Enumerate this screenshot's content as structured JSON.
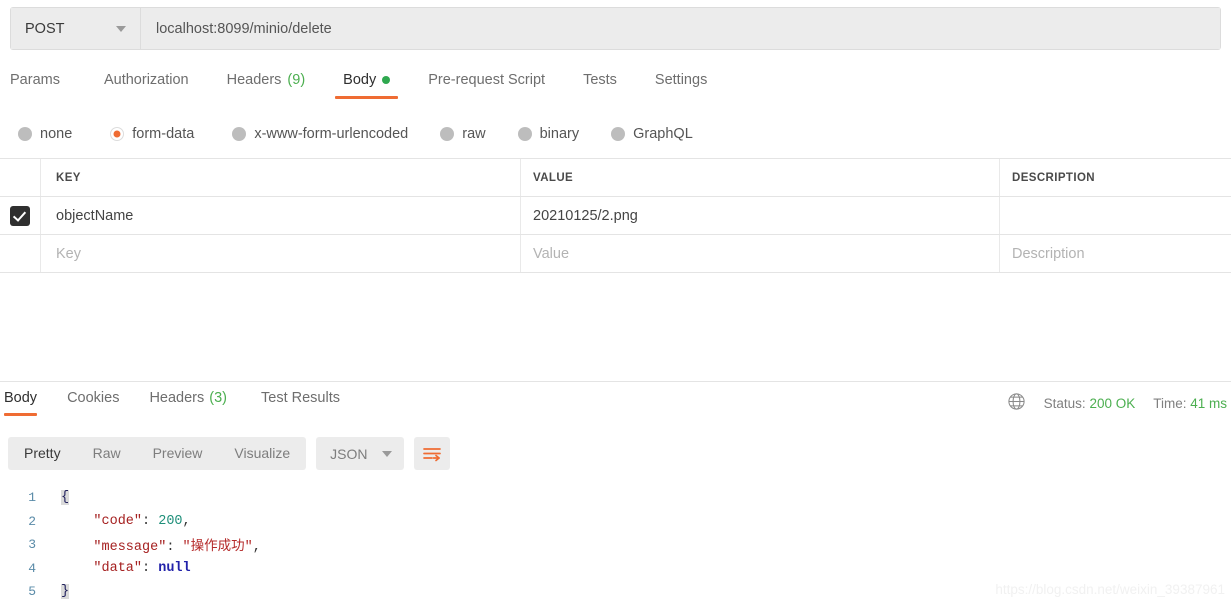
{
  "request": {
    "method": "POST",
    "url": "localhost:8099/minio/delete",
    "tabs": [
      {
        "label": "Params",
        "count": "",
        "active": false,
        "dot": false
      },
      {
        "label": "Authorization",
        "count": "",
        "active": false,
        "dot": false
      },
      {
        "label": "Headers",
        "count": "(9)",
        "active": false,
        "dot": false
      },
      {
        "label": "Body",
        "count": "",
        "active": true,
        "dot": true
      },
      {
        "label": "Pre-request Script",
        "count": "",
        "active": false,
        "dot": false
      },
      {
        "label": "Tests",
        "count": "",
        "active": false,
        "dot": false
      },
      {
        "label": "Settings",
        "count": "",
        "active": false,
        "dot": false
      }
    ],
    "body_types": [
      {
        "label": "none",
        "selected": false
      },
      {
        "label": "form-data",
        "selected": true
      },
      {
        "label": "x-www-form-urlencoded",
        "selected": false
      },
      {
        "label": "raw",
        "selected": false
      },
      {
        "label": "binary",
        "selected": false
      },
      {
        "label": "GraphQL",
        "selected": false
      }
    ],
    "table": {
      "columns": {
        "key": "KEY",
        "value": "VALUE",
        "description": "DESCRIPTION"
      },
      "rows": [
        {
          "checked": true,
          "key": "objectName",
          "value": "20210125/2.png",
          "description": ""
        }
      ],
      "placeholders": {
        "key": "Key",
        "value": "Value",
        "description": "Description"
      }
    }
  },
  "response": {
    "tabs": [
      {
        "label": "Body",
        "count": "",
        "active": true
      },
      {
        "label": "Cookies",
        "count": "",
        "active": false
      },
      {
        "label": "Headers",
        "count": "(3)",
        "active": false
      },
      {
        "label": "Test Results",
        "count": "",
        "active": false
      }
    ],
    "meta": {
      "status_label": "Status:",
      "status_value": "200 OK",
      "time_label": "Time:",
      "time_value": "41 ms"
    },
    "view_modes": [
      {
        "label": "Pretty",
        "active": true
      },
      {
        "label": "Raw",
        "active": false
      },
      {
        "label": "Preview",
        "active": false
      },
      {
        "label": "Visualize",
        "active": false
      }
    ],
    "format": "JSON",
    "code": {
      "lines": [
        {
          "n": "1",
          "parts": [
            {
              "t": "{",
              "c": "tok-brace"
            }
          ]
        },
        {
          "n": "2",
          "parts": [
            {
              "t": "    ",
              "c": "tok-punct"
            },
            {
              "t": "\"code\"",
              "c": "tok-key"
            },
            {
              "t": ": ",
              "c": "tok-punct"
            },
            {
              "t": "200",
              "c": "tok-num"
            },
            {
              "t": ",",
              "c": "tok-punct"
            }
          ]
        },
        {
          "n": "3",
          "parts": [
            {
              "t": "    ",
              "c": "tok-punct"
            },
            {
              "t": "\"message\"",
              "c": "tok-key"
            },
            {
              "t": ": ",
              "c": "tok-punct"
            },
            {
              "t": "\"操作成功\"",
              "c": "tok-str"
            },
            {
              "t": ",",
              "c": "tok-punct"
            }
          ]
        },
        {
          "n": "4",
          "parts": [
            {
              "t": "    ",
              "c": "tok-punct"
            },
            {
              "t": "\"data\"",
              "c": "tok-key"
            },
            {
              "t": ": ",
              "c": "tok-punct"
            },
            {
              "t": "null",
              "c": "tok-null"
            }
          ]
        },
        {
          "n": "5",
          "parts": [
            {
              "t": "}",
              "c": "tok-brace"
            }
          ]
        }
      ]
    }
  },
  "watermark": "https://blog.csdn.net/weixin_39387961",
  "colors": {
    "accent_orange": "#ef6c33",
    "status_green": "#4caf50",
    "body_dot_green": "#2fa84f",
    "checkbox_dark": "#2f2f2f"
  }
}
